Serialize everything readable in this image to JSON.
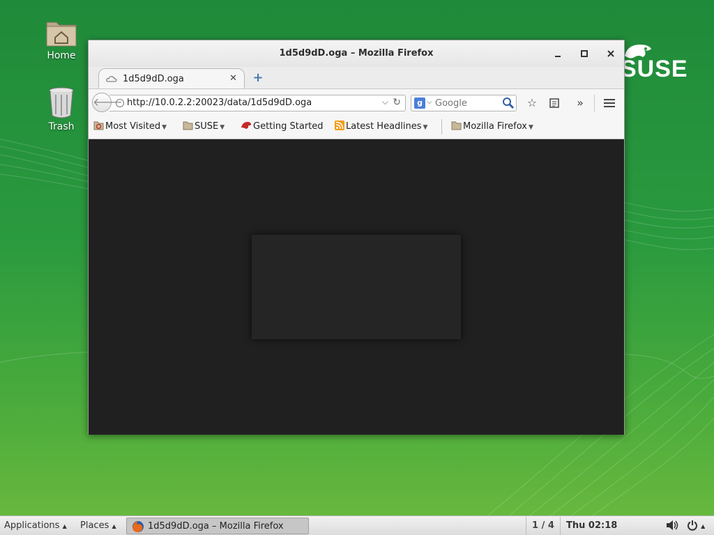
{
  "desktop": {
    "icons": [
      {
        "label": "Home",
        "icon": "home-folder-icon"
      },
      {
        "label": "Trash",
        "icon": "trash-icon"
      }
    ],
    "brand_logo": "SUSE",
    "background_color": "#2a9a3e"
  },
  "window": {
    "title": "1d5d9dD.oga – Mozilla Firefox",
    "controls": {
      "minimize": "minimize-icon",
      "maximize": "maximize-icon",
      "close": "close-icon"
    },
    "tabs": [
      {
        "label": "1d5d9dD.oga",
        "active": true
      }
    ],
    "new_tab_icon": "plus-icon",
    "address": {
      "url": "http://10.0.2.2:20023/data/1d5d9dD.oga"
    },
    "search": {
      "placeholder": "Google",
      "engine": "g"
    },
    "toolbar_icons": [
      "star-icon",
      "reading-list-icon",
      "overflow-chevron-icon",
      "hamburger-menu-icon"
    ],
    "bookmarks": [
      {
        "label": "Most Visited",
        "has_menu": true
      },
      {
        "label": "SUSE",
        "has_menu": true
      },
      {
        "label": "Getting Started",
        "has_menu": false
      },
      {
        "label": "Latest Headlines",
        "has_menu": true
      },
      {
        "label": "Mozilla Firefox",
        "has_menu": true
      }
    ],
    "content_background": "#202020"
  },
  "panel": {
    "applications": "Applications",
    "places": "Places",
    "task": "1d5d9dD.oga – Mozilla Firefox",
    "workspace": "1 / 4",
    "clock": "Thu 02:18"
  }
}
